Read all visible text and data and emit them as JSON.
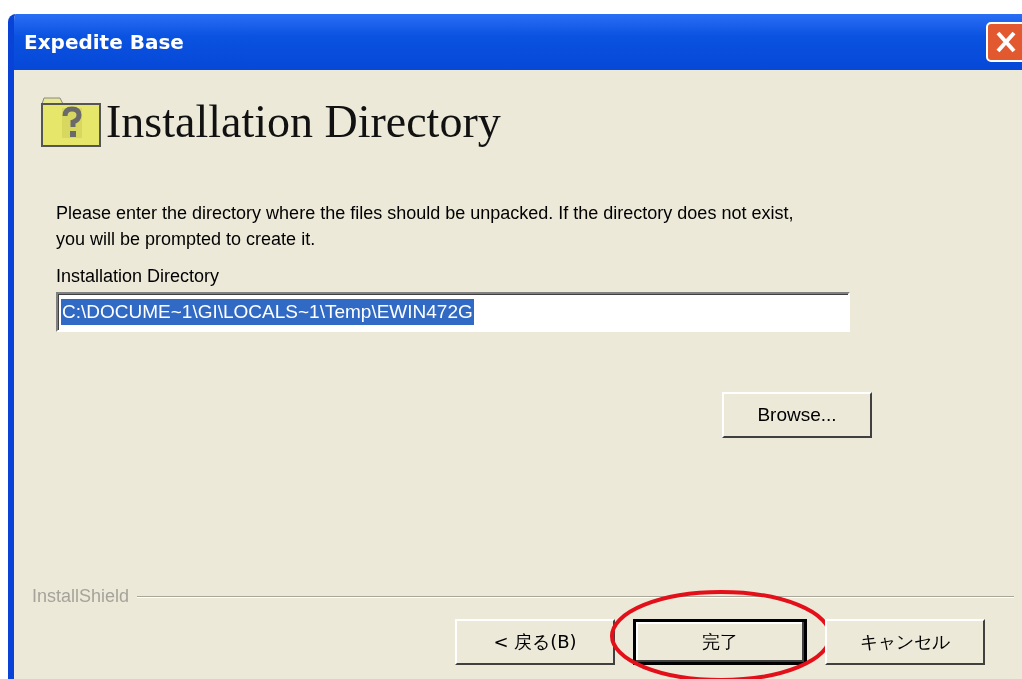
{
  "window": {
    "title": "Expedite Base"
  },
  "heading": "Installation Directory",
  "description": "Please enter the directory where the files should be unpacked.  If the directory does not exist, you will be prompted to create it.",
  "field": {
    "label": "Installation Directory",
    "value": "C:\\DOCUME~1\\GI\\LOCALS~1\\Temp\\EWIN472G",
    "text_selected": true
  },
  "browse_button": "Browse...",
  "brand": "InstallShield",
  "buttons": [
    {
      "label": "< 戻る(B)",
      "default": false,
      "circled": false
    },
    {
      "label": "完了",
      "default": true,
      "circled": true
    },
    {
      "label": "キャンセル",
      "default": false,
      "circled": false
    }
  ]
}
